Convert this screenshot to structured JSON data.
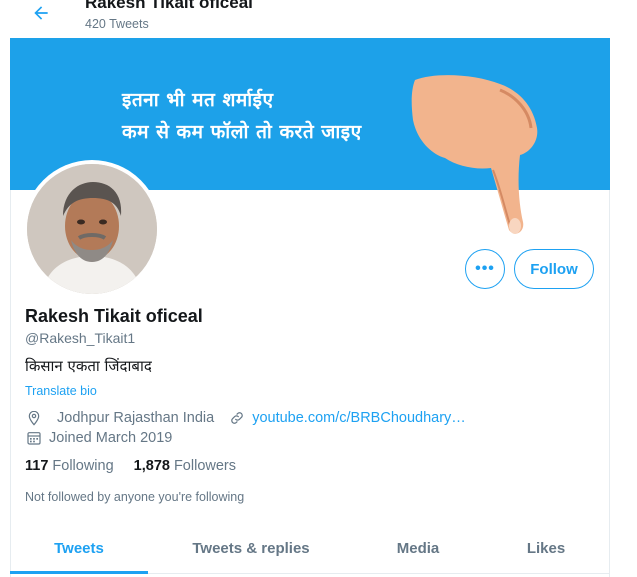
{
  "header": {
    "name": "Rakesh Tikait oficeal",
    "tweet_count": "420 Tweets"
  },
  "banner": {
    "line1": "इतना भी मत शर्माईए",
    "line2": "कम से कम फॉलो तो करते जाइए"
  },
  "actions": {
    "more_label": "•••",
    "follow_label": "Follow"
  },
  "profile": {
    "display_name": "Rakesh Tikait oficeal",
    "handle": "@Rakesh_Tikait1",
    "bio": "किसान एकता जिंदाबाद",
    "translate_label": "Translate bio",
    "location": "Jodhpur Rajasthan India",
    "website": "youtube.com/c/BRBChoudhary…",
    "joined": "Joined March 2019"
  },
  "stats": {
    "following_count": "117",
    "following_label": "Following",
    "followers_count": "1,878",
    "followers_label": "Followers"
  },
  "not_followed_text": "Not followed by anyone you're following",
  "tabs": [
    {
      "label": "Tweets",
      "active": true
    },
    {
      "label": "Tweets & replies",
      "active": false
    },
    {
      "label": "Media",
      "active": false
    },
    {
      "label": "Likes",
      "active": false
    }
  ],
  "colors": {
    "accent": "#1da1f2",
    "banner": "#1da1e9",
    "secondary_text": "#657786"
  },
  "icons": {
    "back": "arrow-left-icon",
    "location": "location-pin-icon",
    "link": "link-icon",
    "calendar": "calendar-icon"
  }
}
